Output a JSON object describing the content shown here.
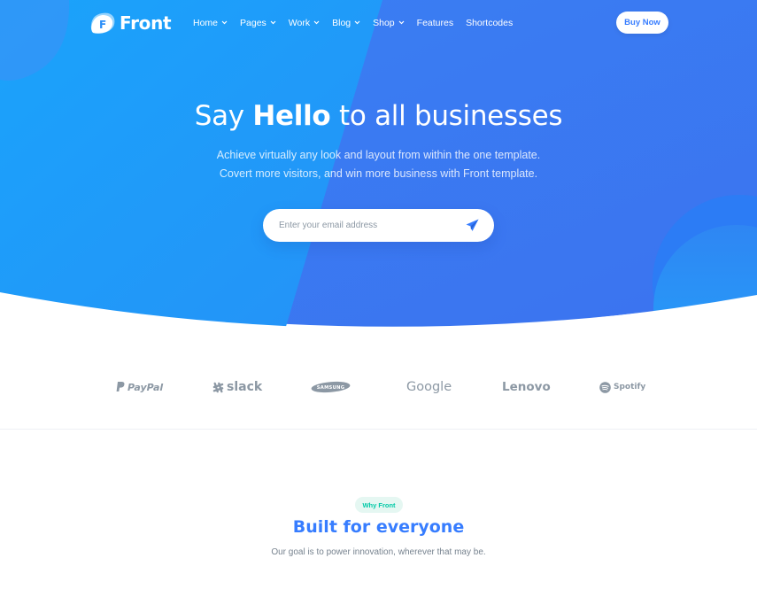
{
  "colors": {
    "primary": "#377dff",
    "hero_light": "#1a9cfa",
    "hero_dark": "#3b7cf2",
    "logo_gray": "#8c98a4",
    "badge_green": "#00c9a7",
    "badge_bg": "#e5f7f2",
    "text_muted": "#77838f"
  },
  "brand": {
    "name": "Front",
    "mark_letter": "F",
    "icon": "front-logo-icon"
  },
  "nav": {
    "items": [
      {
        "label": "Home",
        "has_dropdown": true
      },
      {
        "label": "Pages",
        "has_dropdown": true
      },
      {
        "label": "Work",
        "has_dropdown": true
      },
      {
        "label": "Blog",
        "has_dropdown": true
      },
      {
        "label": "Shop",
        "has_dropdown": true
      },
      {
        "label": "Features",
        "has_dropdown": false
      },
      {
        "label": "Shortcodes",
        "has_dropdown": false
      }
    ],
    "cta_label": "Buy Now"
  },
  "hero": {
    "title_pre": "Say ",
    "title_bold": "Hello",
    "title_post": " to all businesses",
    "subtitle_line1": "Achieve virtually any look and layout from within the one template.",
    "subtitle_line2": "Covert more visitors, and win more business with Front template.",
    "email_placeholder": "Enter your email address",
    "submit_icon": "paper-plane-icon"
  },
  "logos": [
    {
      "name": "PayPal",
      "icon": "paypal-icon"
    },
    {
      "name": "slack",
      "icon": "slack-icon"
    },
    {
      "name": "SAMSUNG",
      "icon": "samsung-logo"
    },
    {
      "name": "Google",
      "icon": ""
    },
    {
      "name": "Lenovo",
      "icon": ""
    },
    {
      "name": "Spotify",
      "icon": "spotify-icon"
    }
  ],
  "intro": {
    "badge": "Why Front",
    "title_pre": "Built for ",
    "title_bold": "everyone",
    "description": "Our goal is to power innovation, wherever that may be."
  }
}
